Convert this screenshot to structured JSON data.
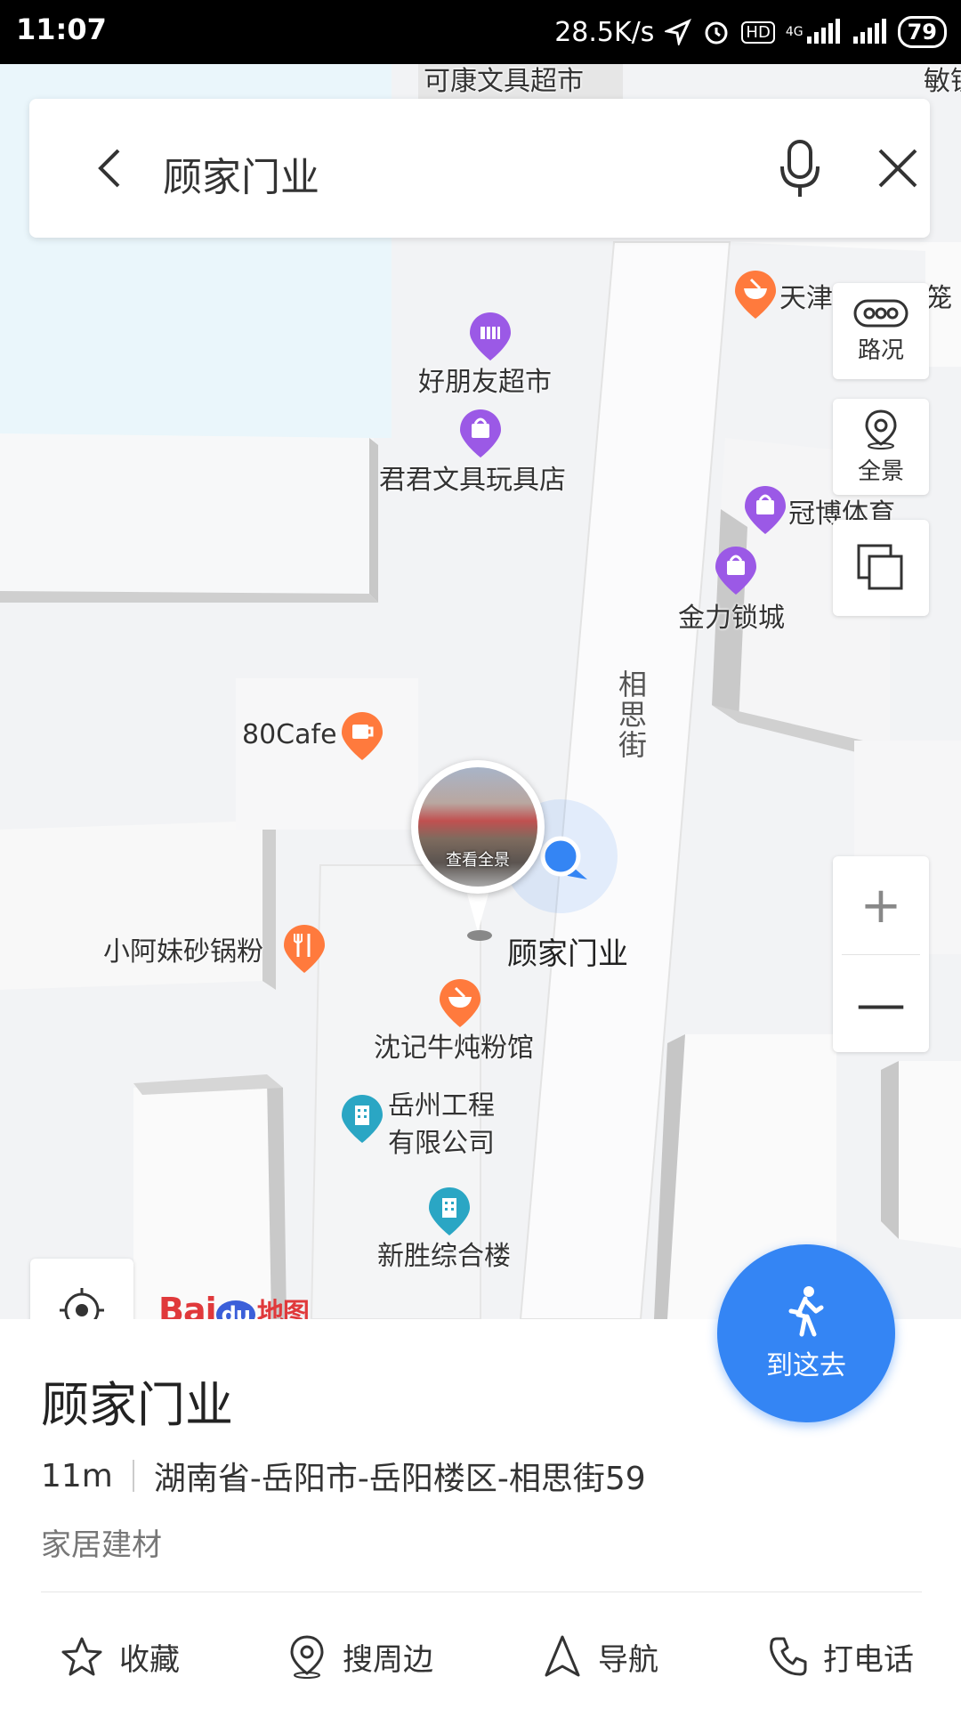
{
  "status_bar": {
    "time": "11:07",
    "speed": "28.5K/s",
    "hd": "HD",
    "network": "4G",
    "battery": "79"
  },
  "search": {
    "query": "顾家门业",
    "back_icon": "chevron-left-icon",
    "mic_icon": "microphone-icon",
    "close_icon": "close-icon"
  },
  "map": {
    "top_labels": [
      "可康文具超市",
      "敏锐"
    ],
    "street": "相思街",
    "pois": [
      {
        "name": "好朋友超市",
        "kind": "supermarket",
        "color": "#9b59e6"
      },
      {
        "name": "君君文具玩具店",
        "kind": "shop",
        "color": "#9b59e6"
      },
      {
        "name": "天津",
        "kind": "restaurant",
        "color": "#ff7a3d"
      },
      {
        "name": "笼",
        "kind": "text",
        "color": "#333333"
      },
      {
        "name": "冠博体育",
        "kind": "shop",
        "color": "#9b59e6"
      },
      {
        "name": "金力锁城",
        "kind": "shop",
        "color": "#9b59e6"
      },
      {
        "name": "80Cafe",
        "kind": "cafe",
        "color": "#ff7a3d"
      },
      {
        "name": "小阿妹砂锅粉",
        "kind": "restaurant",
        "color": "#ff7a3d"
      },
      {
        "name": "沈记牛炖粉馆",
        "kind": "restaurant",
        "color": "#ff7a3d"
      },
      {
        "name": "岳州工程\n有限公司",
        "kind": "company",
        "color": "#2aa6c4"
      },
      {
        "name": "新胜综合楼",
        "kind": "building",
        "color": "#2aa6c4"
      }
    ],
    "pano_text": "查看全景",
    "destination": "顾家门业",
    "logo": {
      "bai": "Bai",
      "du": "du",
      "ditu": "地图"
    }
  },
  "tools": {
    "traffic": "路况",
    "panorama": "全景",
    "zoom_in": "+",
    "zoom_out": "—"
  },
  "go": {
    "label": "到这去"
  },
  "place": {
    "title": "顾家门业",
    "distance": "11m",
    "address": "湖南省-岳阳市-岳阳楼区-相思街59",
    "category": "家居建材"
  },
  "actions": [
    {
      "label": "收藏",
      "icon": "star-icon"
    },
    {
      "label": "搜周边",
      "icon": "location-pin-icon"
    },
    {
      "label": "导航",
      "icon": "navigation-arrow-icon"
    },
    {
      "label": "打电话",
      "icon": "phone-icon"
    }
  ]
}
